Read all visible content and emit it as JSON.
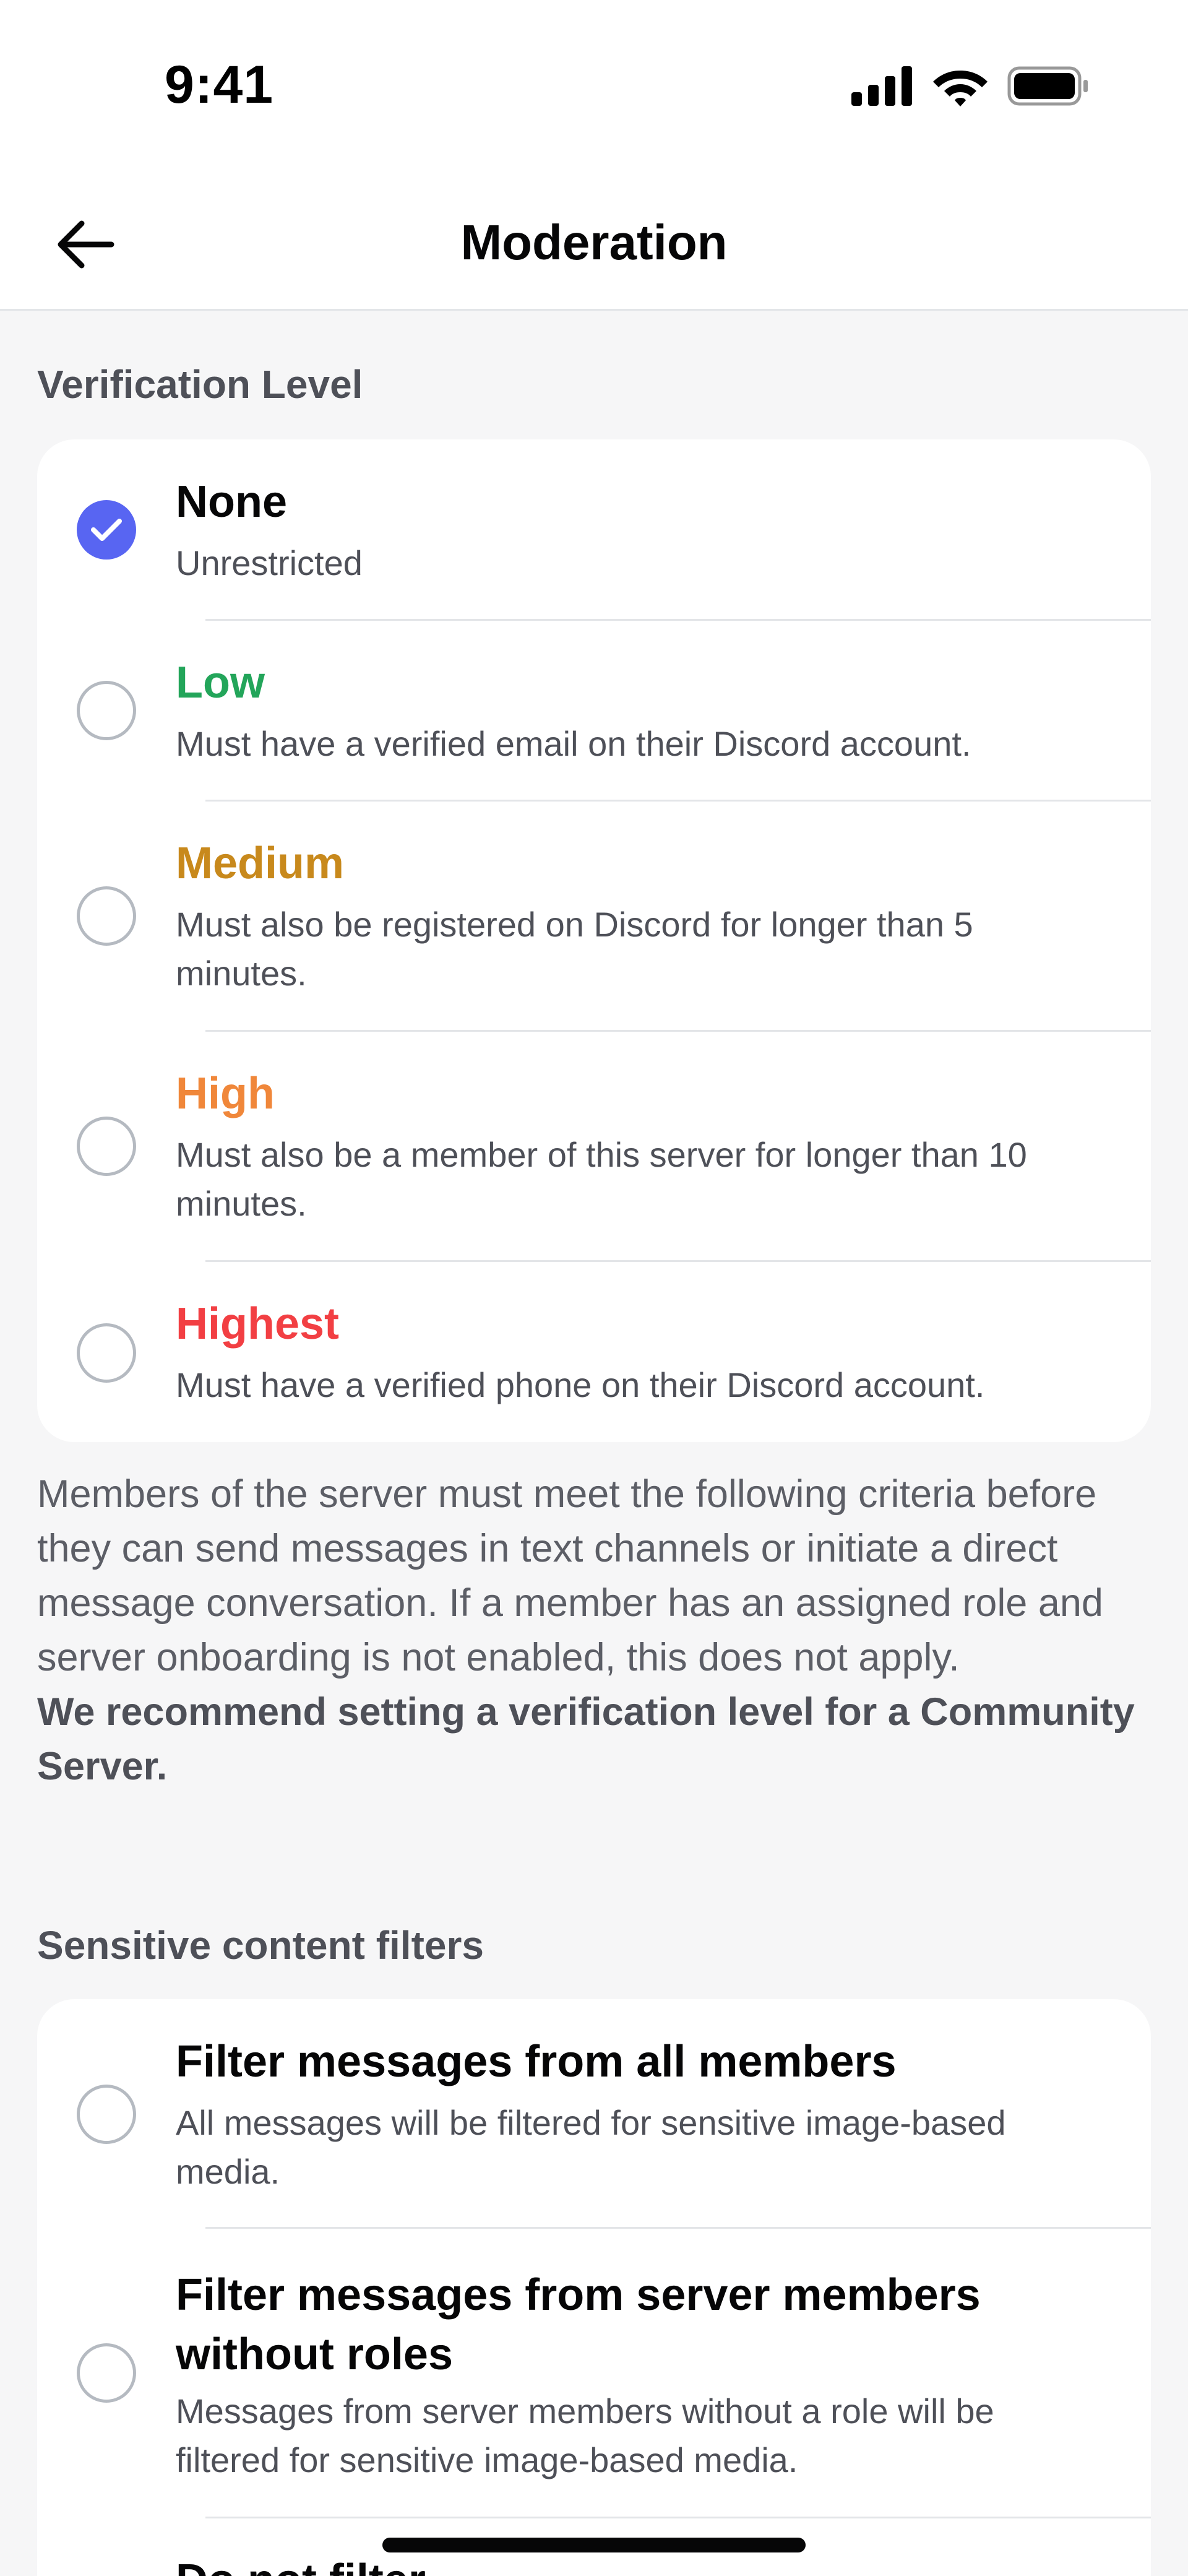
{
  "status_bar": {
    "time": "9:41"
  },
  "header": {
    "title": "Moderation"
  },
  "verification": {
    "section_title": "Verification Level",
    "options": [
      {
        "title": "None",
        "description": "Unrestricted",
        "color": "#060607",
        "selected": true
      },
      {
        "title": "Low",
        "description": "Must have a verified email on their Discord account.",
        "color": "#23a55a",
        "selected": false
      },
      {
        "title": "Medium",
        "description": "Must also be registered on Discord for longer than 5 minutes.",
        "color": "#c8891c",
        "selected": false
      },
      {
        "title": "High",
        "description": "Must also be a member of this server for longer than 10 minutes.",
        "color": "#f0873a",
        "selected": false
      },
      {
        "title": "Highest",
        "description": "Must have a verified phone on their Discord account.",
        "color": "#f23f43",
        "selected": false
      }
    ],
    "help_text": "Members of the server must meet the following criteria before they can send messages in text channels or initiate a direct message conversation. If a member has an assigned role and server onboarding is not enabled, this does not apply.",
    "recommendation": "We recommend setting a verification level for a Community Server."
  },
  "content_filters": {
    "section_title": "Sensitive content filters",
    "options": [
      {
        "title": "Filter messages from all members",
        "description": "All messages will be filtered for sensitive image-based media.",
        "selected": false
      },
      {
        "title": "Filter messages from server members without roles",
        "description": "Messages from server members without a role will be filtered for sensitive image-based media.",
        "selected": false
      },
      {
        "title": "Do not filter",
        "description": "",
        "selected": false
      }
    ]
  },
  "colors": {
    "accent": "#5865f2",
    "background": "#f6f6f7",
    "card": "#ffffff"
  }
}
